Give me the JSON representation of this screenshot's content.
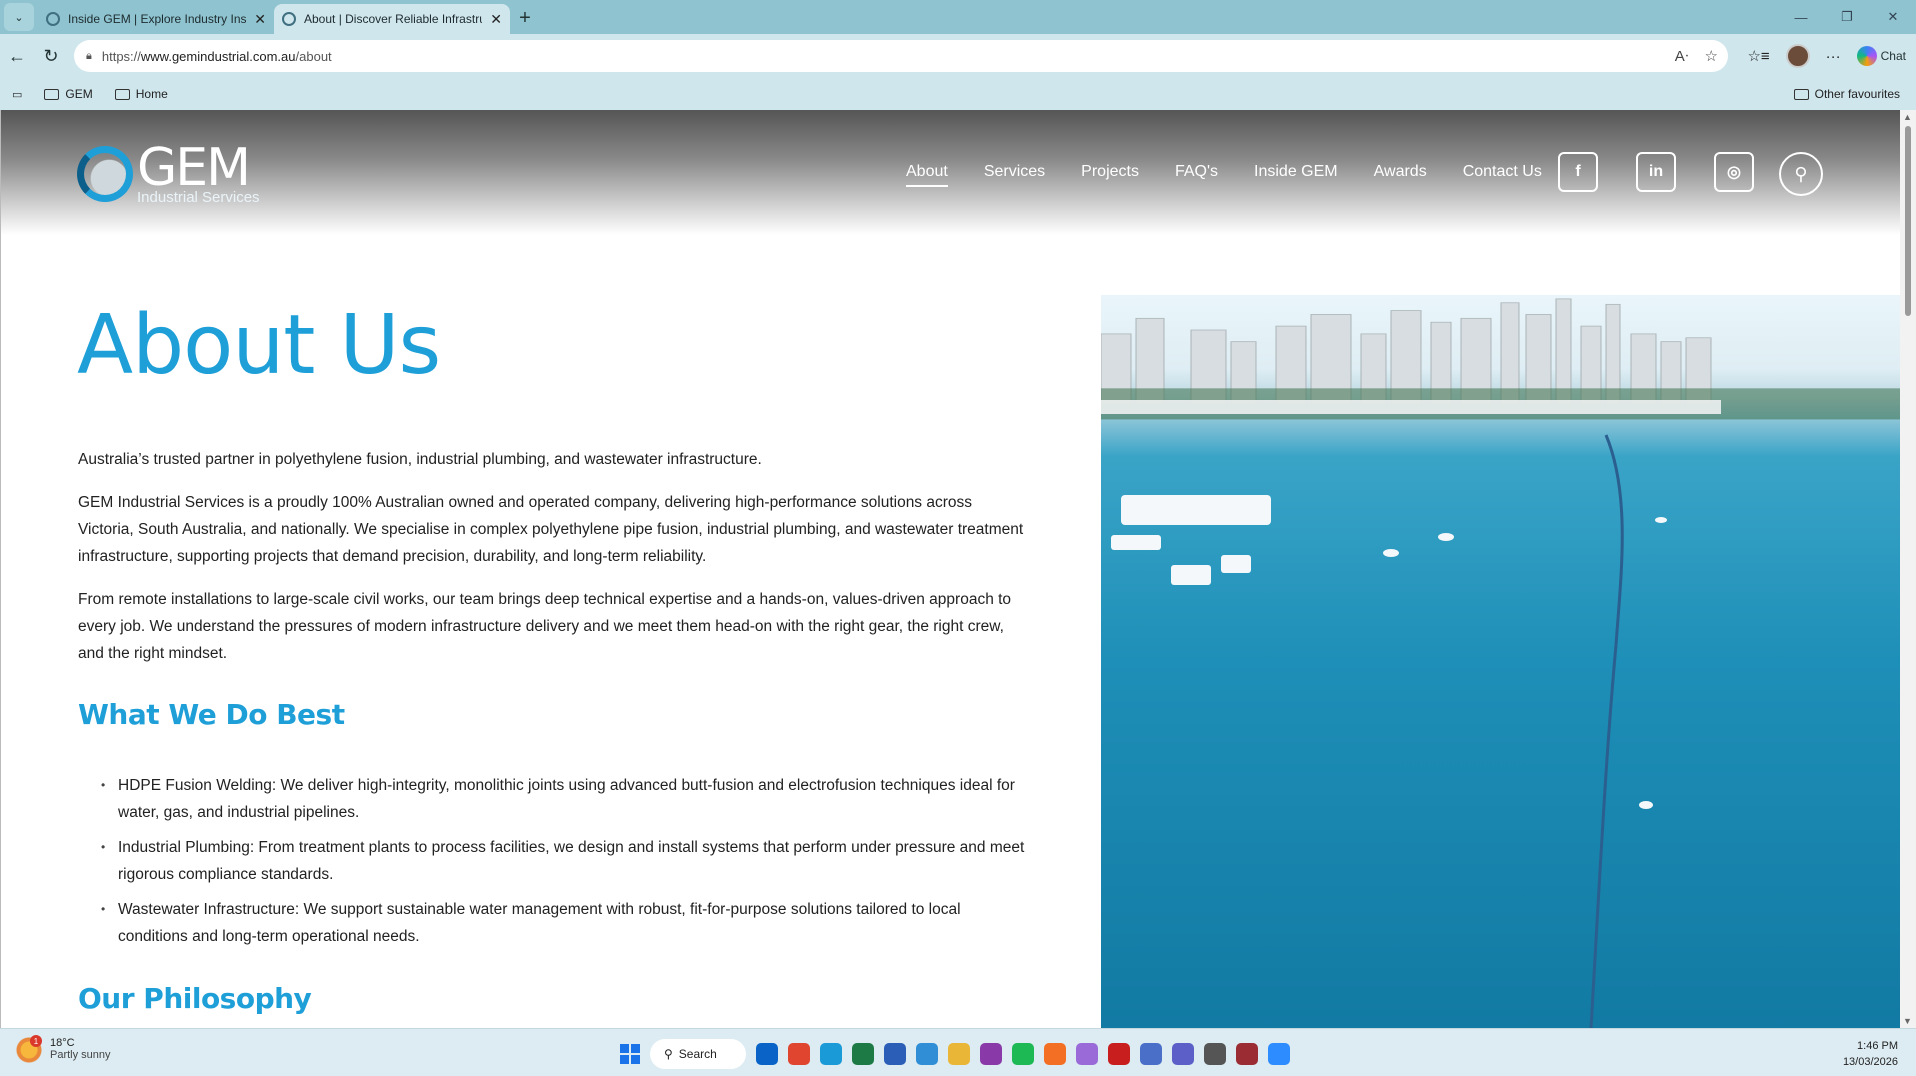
{
  "browser": {
    "tabs": [
      {
        "title": "Inside GEM | Explore Industry Insig",
        "active": false
      },
      {
        "title": "About | Discover Reliable Infrastru",
        "active": true
      }
    ],
    "url_prefix": "https://",
    "url_host": "www.gemindustrial.com.au",
    "url_path": "/about",
    "copilot_label": "Chat",
    "bookmarks": [
      {
        "label": "GEM"
      },
      {
        "label": "Home"
      }
    ],
    "other_favourites": "Other favourites"
  },
  "site": {
    "logo": {
      "big": "GEM",
      "small": "Industrial Services"
    },
    "menu": [
      "About",
      "Services",
      "Projects",
      "FAQ's",
      "Inside GEM",
      "Awards",
      "Contact Us"
    ],
    "active_menu": "About",
    "social": [
      {
        "name": "facebook-icon",
        "glyph": "f"
      },
      {
        "name": "linkedin-icon",
        "glyph": "in"
      },
      {
        "name": "instagram-icon",
        "glyph": "◎"
      }
    ],
    "colors": {
      "accent": "#1e9fd8"
    }
  },
  "content": {
    "title": "About Us",
    "intro": "Australia’s trusted partner in polyethylene fusion, industrial plumbing, and wastewater infrastructure.",
    "para1": "GEM Industrial Services is a proudly 100% Australian owned and operated company, delivering high-performance solutions across Victoria, South Australia, and nationally. We specialise in complex polyethylene pipe fusion, industrial plumbing, and wastewater treatment infrastructure, supporting projects that demand precision, durability, and long-term reliability.",
    "para2": "From remote installations to large-scale civil works, our team brings deep technical expertise and a hands-on, values-driven approach to every job. We understand the pressures of modern infrastructure delivery and we meet them head-on with the right gear, the right crew, and the right mindset.",
    "h_best": "What We Do Best",
    "bullets": [
      "HDPE Fusion Welding: We deliver high-integrity, monolithic joints using advanced butt-fusion and electrofusion techniques ideal for water, gas, and industrial pipelines.",
      "Industrial Plumbing: From treatment plants to process facilities, we design and install systems that perform under pressure and meet rigorous compliance standards.",
      "Wastewater Infrastructure: We support sustainable water management with robust, fit-for-purpose solutions tailored to local conditions and long-term operational needs."
    ],
    "h_philosophy": "Our Philosophy"
  },
  "taskbar": {
    "weather_temp": "18°C",
    "weather_desc": "Partly sunny",
    "weather_badge": "1",
    "search_label": "Search",
    "time": "1:46 PM",
    "date": "13/03/2026",
    "apps": [
      {
        "name": "outlook-icon",
        "color": "#0a64c8"
      },
      {
        "name": "chrome-icon",
        "color": "#e0452f"
      },
      {
        "name": "edge-icon",
        "color": "#1a9bd8"
      },
      {
        "name": "excel-icon",
        "color": "#1d7a45"
      },
      {
        "name": "word-icon",
        "color": "#2b5fb7"
      },
      {
        "name": "photos-icon",
        "color": "#2f8ed6"
      },
      {
        "name": "file-explorer-icon",
        "color": "#e9b638"
      },
      {
        "name": "onenote-icon",
        "color": "#8a3aa8"
      },
      {
        "name": "spotify-icon",
        "color": "#1db954"
      },
      {
        "name": "firefox-icon",
        "color": "#f36f23"
      },
      {
        "name": "snipping-tool-icon",
        "color": "#9a6bd8"
      },
      {
        "name": "acrobat-icon",
        "color": "#c81e1e"
      },
      {
        "name": "remote-desktop-icon",
        "color": "#4a6fc9"
      },
      {
        "name": "teams-icon",
        "color": "#5b5fc7"
      },
      {
        "name": "calculator-icon",
        "color": "#555555"
      },
      {
        "name": "davinci-icon",
        "color": "#9b2c33"
      },
      {
        "name": "zoom-icon",
        "color": "#2d8cff"
      }
    ]
  }
}
